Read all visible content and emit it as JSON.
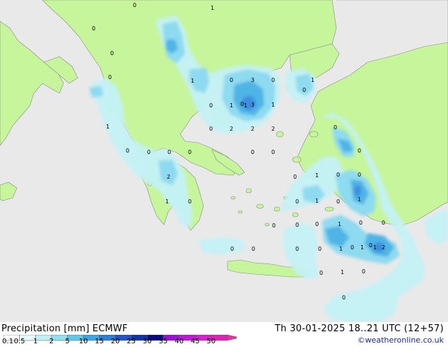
{
  "title": "Precipitation [mm]  ECMWF",
  "valid_time": "Th 30-01-2025 18..21 UTC (12+57)",
  "credit": "©weatheronline.co.uk",
  "legend": {
    "ticks": [
      "0.1",
      "0.5",
      "1",
      "2",
      "5",
      "10",
      "15",
      "20",
      "25",
      "30",
      "35",
      "40",
      "45",
      "50"
    ],
    "colors": [
      "#ffffff",
      "#e6fafa",
      "#bff0f5",
      "#90e0f0",
      "#5ec8ec",
      "#3aa6e6",
      "#2a7fd8",
      "#1f55c4",
      "#1632a8",
      "#0a0a82",
      "#9a10d8",
      "#c018d8",
      "#d820d0",
      "#e020b8",
      "#e830a0"
    ]
  },
  "map": {
    "colors": {
      "sea": "#e9e9e9",
      "land": "#c6f59c",
      "precip_light": "#c4f2f6",
      "precip_mid": "#8edaf0",
      "precip_heavy": "#50b4e6",
      "precip_core": "#3c8ee0"
    },
    "values": [
      "0",
      "1",
      "0",
      "0",
      "0",
      "1",
      "0",
      "3",
      "0",
      "1",
      "0",
      "0",
      "1",
      "0",
      "1",
      "3",
      "1",
      "0",
      "2",
      "2",
      "2",
      "1",
      "0",
      "0",
      "0",
      "0",
      "0",
      "0",
      "2",
      "0",
      "0",
      "0",
      "0",
      "1",
      "0",
      "0",
      "1",
      "0",
      "0",
      "1",
      "1",
      "0",
      "0",
      "0",
      "1",
      "0",
      "0",
      "0",
      "0",
      "0",
      "0",
      "1",
      "0",
      "1",
      "1",
      "0",
      "2",
      "0",
      "1",
      "0",
      "0"
    ]
  }
}
